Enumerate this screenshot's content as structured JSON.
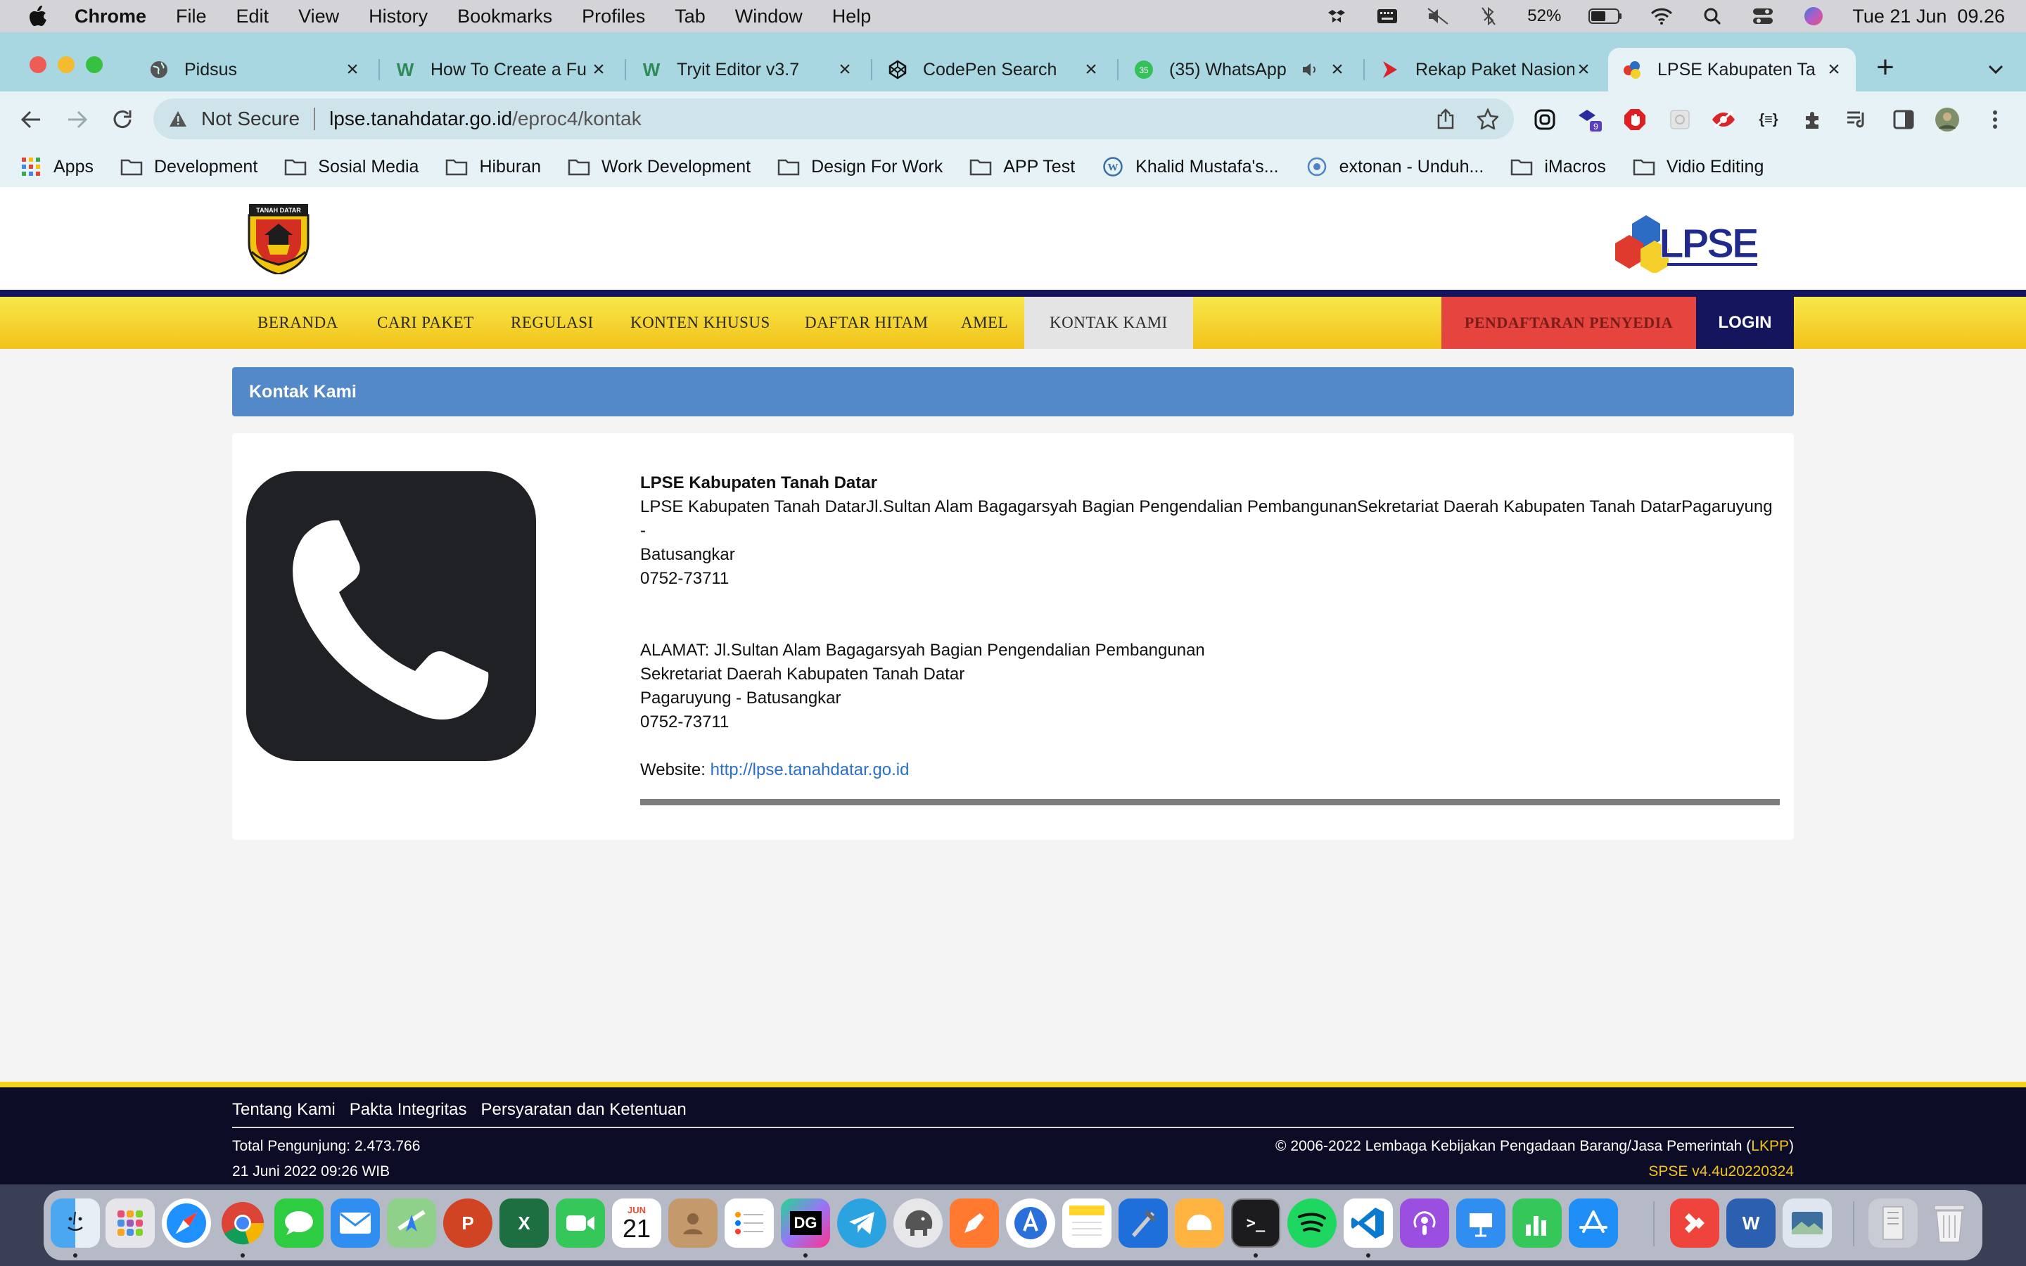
{
  "menubar": {
    "app": "Chrome",
    "items": [
      "File",
      "Edit",
      "View",
      "History",
      "Bookmarks",
      "Profiles",
      "Tab",
      "Window",
      "Help"
    ],
    "battery": "52%",
    "datetime": "Tue 21 Jun  09.26"
  },
  "tabs": [
    {
      "title": "Pidsus",
      "favicon": "globe-icon"
    },
    {
      "title": "How To Create a Fu",
      "favicon": "webflow-icon"
    },
    {
      "title": "Tryit Editor v3.7",
      "favicon": "webflow-icon"
    },
    {
      "title": "CodePen Search",
      "favicon": "codepen-icon"
    },
    {
      "title": "(35) WhatsApp",
      "favicon": "whatsapp-icon",
      "badge": "35"
    },
    {
      "title": "Rekap Paket Nasion",
      "favicon": "arrow-red-icon"
    },
    {
      "title": "LPSE Kabupaten Ta",
      "favicon": "lpse-icon",
      "active": true
    }
  ],
  "omnibox": {
    "security": "Not Secure",
    "host": "lpse.tanahdatar.go.id",
    "path": "/eproc4/kontak"
  },
  "extensions": {
    "badge": "9"
  },
  "bookmarks": [
    {
      "label": "Apps",
      "icon": "apps-grid-icon"
    },
    {
      "label": "Development",
      "icon": "folder-icon"
    },
    {
      "label": "Sosial Media",
      "icon": "folder-icon"
    },
    {
      "label": "Hiburan",
      "icon": "folder-icon"
    },
    {
      "label": "Work Development",
      "icon": "folder-icon"
    },
    {
      "label": "Design For Work",
      "icon": "folder-icon"
    },
    {
      "label": "APP Test",
      "icon": "folder-icon"
    },
    {
      "label": "Khalid Mustafa's...",
      "icon": "wordpress-icon"
    },
    {
      "label": "extonan - Unduh...",
      "icon": "globe-icon"
    },
    {
      "label": "iMacros",
      "icon": "folder-icon"
    },
    {
      "label": "Vidio Editing",
      "icon": "folder-icon"
    }
  ],
  "site": {
    "crest_text": "TANAH DATAR",
    "logo_text": "LPSE",
    "nav": [
      "BERANDA",
      "CARI PAKET",
      "REGULASI",
      "KONTEN KHUSUS",
      "DAFTAR HITAM",
      "AMEL",
      "KONTAK KAMI"
    ],
    "nav_active": "KONTAK KAMI",
    "register": "PENDAFTARAN PENYEDIA",
    "login": "LOGIN",
    "panel_title": "Kontak Kami",
    "contact": {
      "org": "LPSE Kabupaten Tanah Datar",
      "line1": "LPSE Kabupaten Tanah DatarJl.Sultan Alam Bagagarsyah Bagian Pengendalian PembangunanSekretariat Daerah Kabupaten Tanah DatarPagaruyung -",
      "line2": "Batusangkar",
      "phone1": "0752-73711",
      "addr1": "ALAMAT: Jl.Sultan Alam Bagagarsyah Bagian Pengendalian Pembangunan",
      "addr2": "Sekretariat Daerah Kabupaten Tanah Datar",
      "addr3": "Pagaruyung - Batusangkar",
      "phone2": "0752-73711",
      "website_label": "Website:",
      "website_url": "http://lpse.tanahdatar.go.id"
    },
    "footer": {
      "links": [
        "Tentang Kami",
        "Pakta Integritas",
        "Persyaratan dan Ketentuan"
      ],
      "visitors": "Total Pengunjung: 2.473.766",
      "date": "21 Juni 2022 09:26 WIB",
      "copyright_prefix": "© 2006-2022 Lembaga Kebijakan Pengadaan Barang/Jasa Pemerintah (",
      "copyright_link": "LKPP",
      "copyright_suffix": ")",
      "version": "SPSE v4.4u20220324"
    }
  },
  "dock": {
    "calendar_month": "JUN",
    "calendar_day": "21",
    "datagrip": "DG"
  },
  "colors": {
    "tabstrip": "#a9d7e1",
    "nav_yellow": "#f3c21a",
    "nav_navy": "#15155e",
    "register_red": "#e6453f",
    "panel_blue": "#5389c8",
    "link_blue": "#2b6fc9"
  }
}
